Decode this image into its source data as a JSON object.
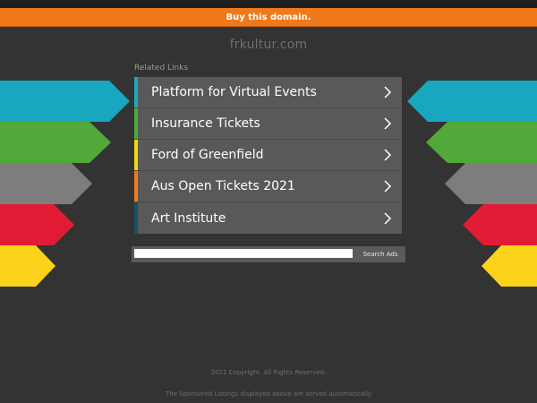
{
  "banner": {
    "text": "Buy this domain."
  },
  "domain": "frkultur.com",
  "related_label": "Related Links",
  "links": [
    {
      "label": "Platform for Virtual Events",
      "color": "#19a9c1"
    },
    {
      "label": "Insurance Tickets",
      "color": "#4aac39"
    },
    {
      "label": "Ford of Greenfield",
      "color": "#f5d213"
    },
    {
      "label": "Aus Open Tickets 2021",
      "color": "#f07a1c"
    },
    {
      "label": "Art Institute",
      "color": "#1d4f63"
    }
  ],
  "arrow_colors": {
    "teal": "#17a8c0",
    "green": "#53a83a",
    "gray": "#7d7d7d",
    "red": "#e21b35",
    "yellow": "#fcd21a"
  },
  "search": {
    "button_label": "Search Ads"
  },
  "footer": {
    "copyright": "2021 Copyright. All Rights Reserved.",
    "disclaimer": "The Sponsored Listings displayed above are served automatically"
  }
}
